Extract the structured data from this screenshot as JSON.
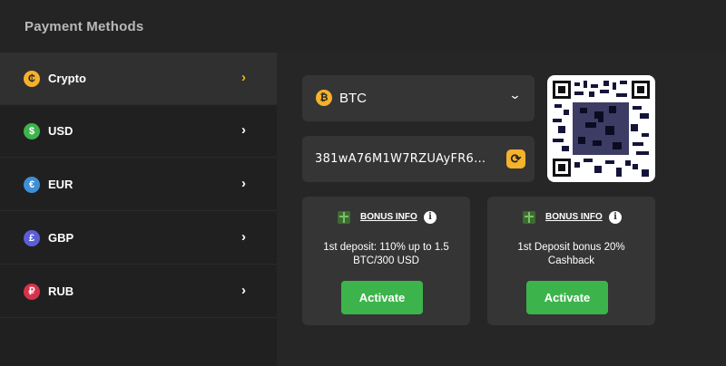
{
  "header": {
    "title": "Payment Methods"
  },
  "sidebar": {
    "items": [
      {
        "label": "Crypto",
        "icon": "crypto-coin-icon",
        "glyph": "₵",
        "color": "#f5b22b",
        "active": true
      },
      {
        "label": "USD",
        "icon": "dollar-icon",
        "glyph": "$",
        "color": "#3cb44b",
        "active": false
      },
      {
        "label": "EUR",
        "icon": "euro-icon",
        "glyph": "€",
        "color": "#3d8fd6",
        "active": false
      },
      {
        "label": "GBP",
        "icon": "pound-icon",
        "glyph": "£",
        "color": "#5b5fd6",
        "active": false
      },
      {
        "label": "RUB",
        "icon": "ruble-icon",
        "glyph": "₽",
        "color": "#d6334a",
        "active": false
      }
    ]
  },
  "currency_select": {
    "selected": "BTC",
    "icon": "bitcoin-icon",
    "glyph": "₿"
  },
  "address": {
    "value": "381wA76M1W7RZUAyFR6k ...",
    "refresh_icon": "refresh-icon"
  },
  "bonuses": [
    {
      "info_label": "BONUS INFO",
      "description": "1st deposit: 110% up to 1.5 BTC/300 USD",
      "button": "Activate"
    },
    {
      "info_label": "BONUS INFO",
      "description": "1st Deposit bonus 20% Cashback",
      "button": "Activate"
    }
  ],
  "colors": {
    "accent": "#f5b22b",
    "activate": "#3cb44b"
  }
}
